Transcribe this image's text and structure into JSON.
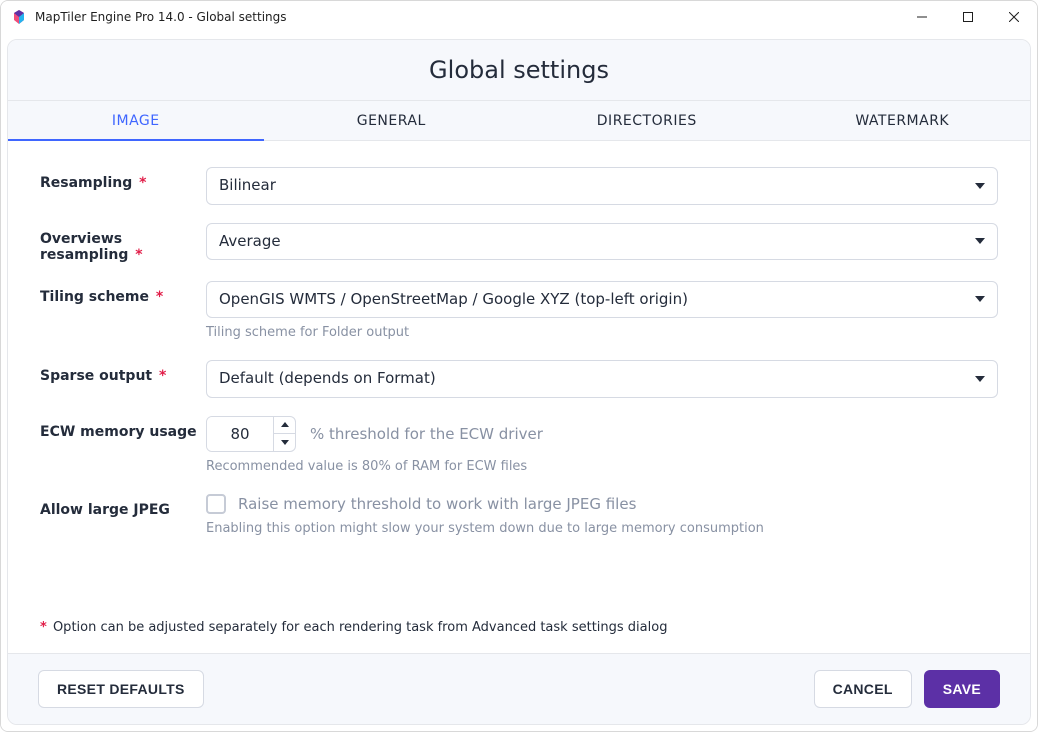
{
  "window": {
    "title": "MapTiler Engine Pro 14.0 - Global settings"
  },
  "header": {
    "title": "Global settings"
  },
  "tabs": [
    {
      "id": "image",
      "label": "IMAGE",
      "active": true
    },
    {
      "id": "general",
      "label": "GENERAL",
      "active": false
    },
    {
      "id": "directories",
      "label": "DIRECTORIES",
      "active": false
    },
    {
      "id": "watermark",
      "label": "WATERMARK",
      "active": false
    }
  ],
  "form": {
    "resampling": {
      "label": "Resampling",
      "required": true,
      "value": "Bilinear"
    },
    "overviews_resampling": {
      "label": "Overviews resampling",
      "required": true,
      "value": "Average"
    },
    "tiling_scheme": {
      "label": "Tiling scheme",
      "required": true,
      "value": "OpenGIS WMTS / OpenStreetMap / Google XYZ (top-left origin)",
      "hint": "Tiling scheme for Folder output"
    },
    "sparse_output": {
      "label": "Sparse output",
      "required": true,
      "value": "Default (depends on Format)"
    },
    "ecw_memory": {
      "label": "ECW memory usage",
      "value": "80",
      "suffix": "% threshold for the ECW driver",
      "hint": "Recommended value is 80% of RAM for ECW files"
    },
    "allow_large_jpeg": {
      "label": "Allow large JPEG",
      "checked": false,
      "option_label": "Raise memory threshold to work with large JPEG files",
      "hint": "Enabling this option might slow your system down due to large memory consumption"
    }
  },
  "footnote": "Option can be adjusted separately for each rendering task from Advanced task settings dialog",
  "footer": {
    "reset": "RESET DEFAULTS",
    "cancel": "CANCEL",
    "save": "SAVE"
  },
  "required_marker": "*"
}
